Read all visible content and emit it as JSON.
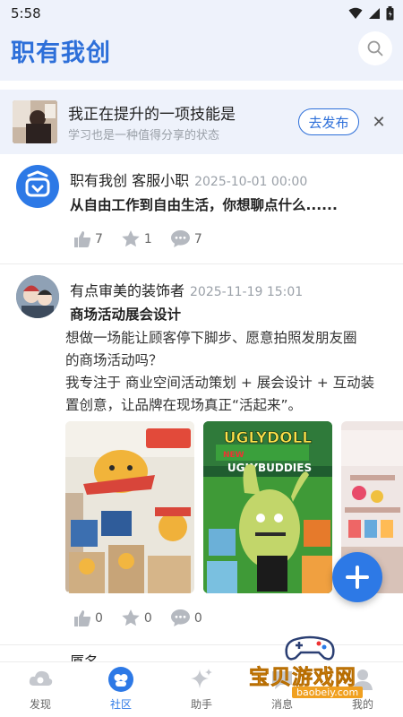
{
  "status_bar": {
    "time": "5:58"
  },
  "header": {
    "title": "职有我创"
  },
  "skill_banner": {
    "title": "我正在提升的一项技能是",
    "subtitle": "学习也是一种值得分享的状态",
    "publish_label": "去发布",
    "close_glyph": "✕"
  },
  "posts": [
    {
      "author": "职有我创 客服小职",
      "time": "2025-10-01 00:00",
      "title": "从自由工作到自由生活，你想聊点什么......",
      "likes": "7",
      "stars": "1",
      "comments": "7"
    },
    {
      "author": "有点审美的装饰者",
      "time": "2025-11-19 15:01",
      "title": "商场活动展会设计",
      "body": [
        "想做一场能让顾客停下脚步、愿意拍照发朋友圈",
        "的商场活动吗？",
        "我专注于 商业空间活动策划 + 展会设计 + 互动装",
        "置创意，让品牌在现场真正“活起来”。"
      ],
      "likes": "0",
      "stars": "0",
      "comments": "0",
      "photo_texts": {
        "ugly_doll": "UGLYDOLL",
        "new_badge": "NEW",
        "ugly_buddies": "UGLYBUDDIES"
      }
    }
  ],
  "partial_post": {
    "author_partial": "厦名"
  },
  "bottom_nav": [
    {
      "label": "发现",
      "icon": "cloud-icon",
      "active": false
    },
    {
      "label": "社区",
      "icon": "community-icon",
      "active": true
    },
    {
      "label": "助手",
      "icon": "sparkle-icon",
      "active": false
    },
    {
      "label": "消息",
      "icon": "message-icon",
      "active": false
    },
    {
      "label": "我的",
      "icon": "profile-icon",
      "active": false
    }
  ],
  "watermark": {
    "text": "宝贝游戏网",
    "url": "baobeiy.com"
  },
  "colors": {
    "accent": "#2d6fd9",
    "banner_bg": "#eef2fb",
    "fab": "#2d79e6"
  }
}
